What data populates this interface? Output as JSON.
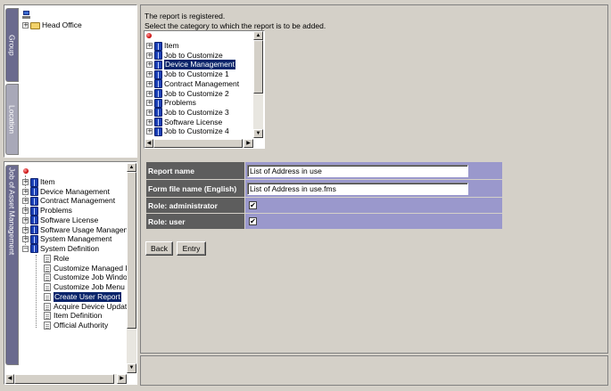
{
  "left_top": {
    "tabs": [
      "Group",
      "Location"
    ],
    "tree_root": "Head Office"
  },
  "left_bottom": {
    "tab": "Job of Asset Management",
    "items": [
      "Item",
      "Device Management",
      "Contract Management",
      "Problems",
      "Software License",
      "Software Usage Managen",
      "System Management",
      "System Definition"
    ],
    "children": [
      "Role",
      "Customize Managed It",
      "Customize Job Windo",
      "Customize Job Menu",
      "Create User Report",
      "Acquire Device Update",
      "Item Definition",
      "Official Authority"
    ],
    "selected_child": "Create User Report"
  },
  "main": {
    "message_1": "The report is registered.",
    "message_2": "Select the category to which the report is to be added.",
    "category_tree": [
      "Item",
      "Job to Customize",
      "Device Management",
      "Job to Customize 1",
      "Contract Management",
      "Job to Customize 2",
      "Problems",
      "Job to Customize 3",
      "Software License",
      "Job to Customize 4"
    ],
    "selected_category": "Device Management",
    "form": {
      "report_name_label": "Report name",
      "report_name_value": "List of Address in use",
      "form_file_label": "Form file name (English)",
      "form_file_value": "List of Address in use.fms",
      "role_admin_label": "Role: administrator",
      "role_user_label": "Role: user",
      "role_admin_checked": true,
      "role_user_checked": true,
      "check_mark": "✔"
    },
    "back_label": "Back",
    "entry_label": "Entry"
  },
  "icons": {
    "expand": "+",
    "collapse": "−",
    "arrow_up": "▲",
    "arrow_down": "▼",
    "arrow_left": "◀",
    "arrow_right": "▶"
  }
}
